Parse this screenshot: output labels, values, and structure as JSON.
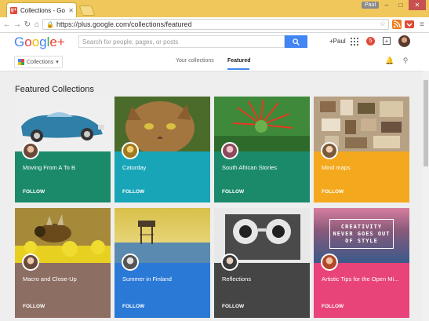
{
  "browser": {
    "tab_title": "Collections - Google+",
    "tab_favicon_text": "g+",
    "url": "https://plus.google.com/collections/featured",
    "profile_chip": "Paul"
  },
  "header": {
    "logo_text": "Google+",
    "search_placeholder": "Search for people, pages, or posts",
    "plus_user": "+Paul",
    "notification_count": "5"
  },
  "subnav": {
    "collections_dropdown": "Collections",
    "tabs": [
      {
        "label": "Your collections",
        "active": false
      },
      {
        "label": "Featured",
        "active": true
      }
    ]
  },
  "section_title": "Featured Collections",
  "cards": [
    {
      "title": "Moving From A To B",
      "follow": "FOLLOW",
      "color": "#1b8a6b"
    },
    {
      "title": "Caturday",
      "follow": "FOLLOW",
      "color": "#18a5b8"
    },
    {
      "title": "South African Stories",
      "follow": "FOLLOW",
      "color": "#1b8a6b"
    },
    {
      "title": "Mind maps",
      "follow": "FOLLOW",
      "color": "#f4a81d"
    },
    {
      "title": "Macro and Close-Up",
      "follow": "FOLLOW",
      "color": "#8d6e63"
    },
    {
      "title": "Summer in Finland",
      "follow": "FOLLOW",
      "color": "#2b79d6"
    },
    {
      "title": "Reflections",
      "follow": "FOLLOW",
      "color": "#454545"
    },
    {
      "title": "Artistic Tips for the Open Mi...",
      "follow": "FOLLOW",
      "color": "#e84479"
    }
  ],
  "card8_image_text": "CREATIVITY NEVER GOES OUT OF STYLE",
  "colors": {
    "accent": "#4285f4",
    "window_frame": "#f0c75a",
    "notification": "#dd4b39"
  }
}
